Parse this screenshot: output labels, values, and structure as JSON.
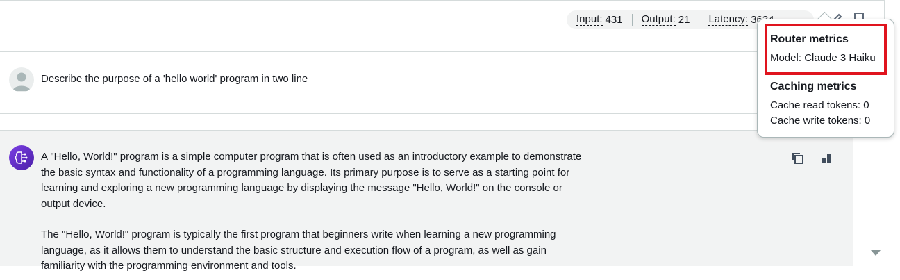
{
  "metrics": {
    "input_label": "Input:",
    "input_value": "431",
    "output_label": "Output:",
    "output_value": "21",
    "latency_label": "Latency:",
    "latency_value": "3634"
  },
  "user_message": {
    "text": "Describe the purpose of a 'hello world' program in two line"
  },
  "assistant_message": {
    "paragraphs": [
      "A \"Hello, World!\" program is a simple computer program that is often used as an introductory example to demonstrate the basic syntax and functionality of a programming language. Its primary purpose is to serve as a starting point for learning and exploring a new programming language by displaying the message \"Hello, World!\" on the console or output device.",
      "The \"Hello, World!\" program is typically the first program that beginners write when learning a new programming language, as it allows them to understand the basic structure and execution flow of a program, as well as gain familiarity with the programming environment and tools."
    ]
  },
  "popover": {
    "router_title": "Router metrics",
    "router_model": "Model: Claude 3 Haiku",
    "caching_title": "Caching metrics",
    "cache_read": "Cache read tokens: 0",
    "cache_write": "Cache write tokens: 0"
  },
  "icons": {
    "edit": "pencil-icon",
    "copy_top": "copy-icon",
    "copy": "copy-icon",
    "metrics": "bar-chart-icon",
    "user_avatar": "user-avatar-icon",
    "bot_avatar": "ai-brain-icon"
  },
  "colors": {
    "highlight": "#e0141e",
    "bot_avatar": "#5a2bc4",
    "assistant_bg": "#f2f3f3"
  }
}
